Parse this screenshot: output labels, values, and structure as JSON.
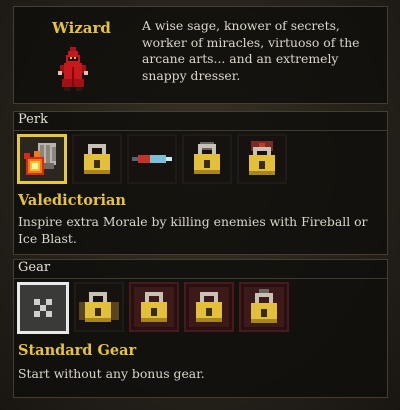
{
  "class_info": {
    "name": "Wizard",
    "description": "A wise sage, knower of secrets, worker of miracles, virtuoso of the arcane arts... and an extremely snappy dresser.",
    "sprite": "red-robed-wizard-icon"
  },
  "perk": {
    "title": "Perk",
    "slots": [
      {
        "icon": "fireball-icon",
        "selected": true,
        "locked": false
      },
      {
        "icon": "lock-icon",
        "locked": true
      },
      {
        "icon": "lock-icon",
        "locked": true
      },
      {
        "icon": "lock-icon",
        "locked": true
      },
      {
        "icon": "lock-icon",
        "locked": true
      }
    ],
    "selected_name": "Valedictorian",
    "selected_description": "Inspire extra Morale by killing enemies with Fireball or Ice Blast."
  },
  "gear": {
    "title": "Gear",
    "slots": [
      {
        "icon": "x-icon",
        "selected": true,
        "locked": false
      },
      {
        "icon": "lock-icon",
        "locked": true
      },
      {
        "icon": "lock-icon",
        "locked": true
      },
      {
        "icon": "lock-icon",
        "locked": true
      },
      {
        "icon": "lock-icon",
        "locked": true
      }
    ],
    "selected_name": "Standard Gear",
    "selected_description": "Start without any bonus gear."
  },
  "colors": {
    "highlight": "#e6c93a",
    "selected_gear": "#e9e9e9",
    "item_name": "#e6c43a",
    "locked_red": "#471a1b"
  }
}
